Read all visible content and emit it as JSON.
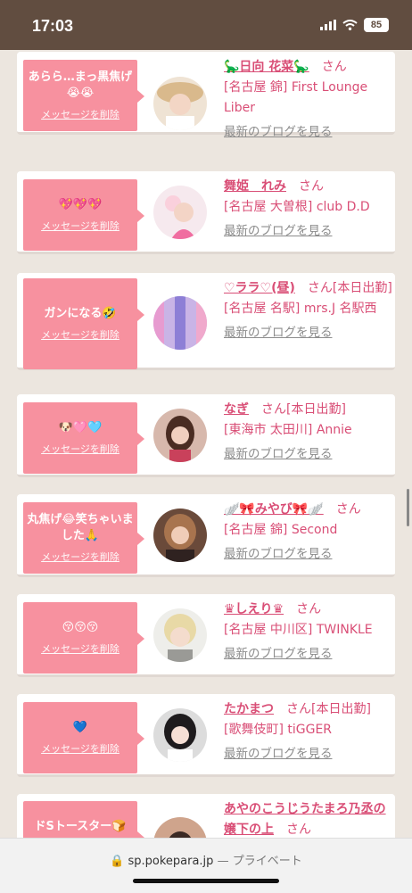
{
  "status_bar": {
    "time": "17:03",
    "battery": "85",
    "signal_icon": "signal-bars-icon",
    "wifi_icon": "wifi-icon"
  },
  "delete_label": "メッセージを削除",
  "san_label": "さん",
  "blog_label": "最新のブログを見る",
  "cards": [
    {
      "message": "あらら…まっ黒焦げ😭😭",
      "name": "🦕日向 花菜🦕",
      "status": "",
      "shop": "[名古屋 錦] First Lounge Liber"
    },
    {
      "message": "💖💖💖",
      "name": "舞姫　れみ",
      "status": "",
      "shop": "[名古屋 大曽根] club D.D"
    },
    {
      "message": "ガンになる🤣",
      "name": "♡ララ♡(昼)",
      "status": "[本日出勤]",
      "shop": "[名古屋 名駅] mrs.J 名駅西"
    },
    {
      "message": "🐶🩷🩵",
      "name": "なぎ",
      "status": "[本日出勤]",
      "shop": "[東海市 太田川] Annie"
    },
    {
      "message": "丸焦げ😂笑ちゃいました🙏",
      "name": "🪽🎀みやび🎀🪽",
      "status": "",
      "shop": "[名古屋 錦] Second"
    },
    {
      "message": "😚😚😚",
      "name": "♛しえり♛",
      "status": "",
      "shop": "[名古屋 中川区] TWINKLE"
    },
    {
      "message": "💙",
      "name": "たかまつ",
      "status": "[本日出勤]",
      "shop": "[歌舞伎町] tiGGER"
    },
    {
      "message": "ドSトースター🍞",
      "name": "あやのこうじうたまろ乃丞の嬢下の上",
      "status": "",
      "shop": ""
    }
  ],
  "browser": {
    "url": "sp.pokepara.jp",
    "private_label": "— プライベート"
  }
}
